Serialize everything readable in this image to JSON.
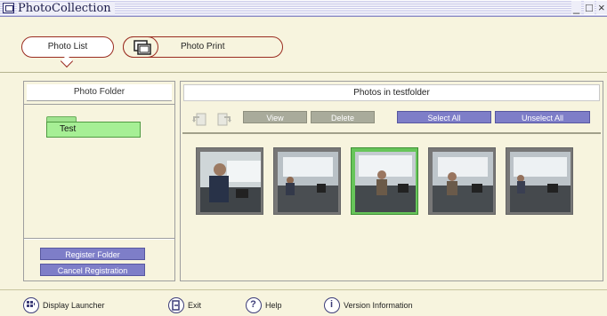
{
  "window": {
    "title": "PhotoCollection",
    "minimize": "_",
    "maximize": "□",
    "close": "×"
  },
  "tabs": {
    "photo_list": "Photo List",
    "photo_print": "Photo Print"
  },
  "left_panel": {
    "header": "Photo Folder",
    "folder_name": "Test",
    "register_button": "Register Folder",
    "cancel_button": "Cancel Registration"
  },
  "right_panel": {
    "header": "Photos in testfolder",
    "view_button": "View",
    "delete_button": "Delete",
    "select_all_button": "Select All",
    "unselect_all_button": "Unselect All",
    "selected_index": 2
  },
  "bottom_bar": {
    "display_launcher": "Display Launcher",
    "exit": "Exit",
    "help": "Help",
    "version": "Version Information"
  },
  "colors": {
    "background": "#f7f4de",
    "accent": "#9a2c20",
    "button_purple": "#7e7ec8",
    "button_gray": "#a9ab9b",
    "folder_green": "#a6ef95",
    "selection_green": "#67c55a"
  }
}
